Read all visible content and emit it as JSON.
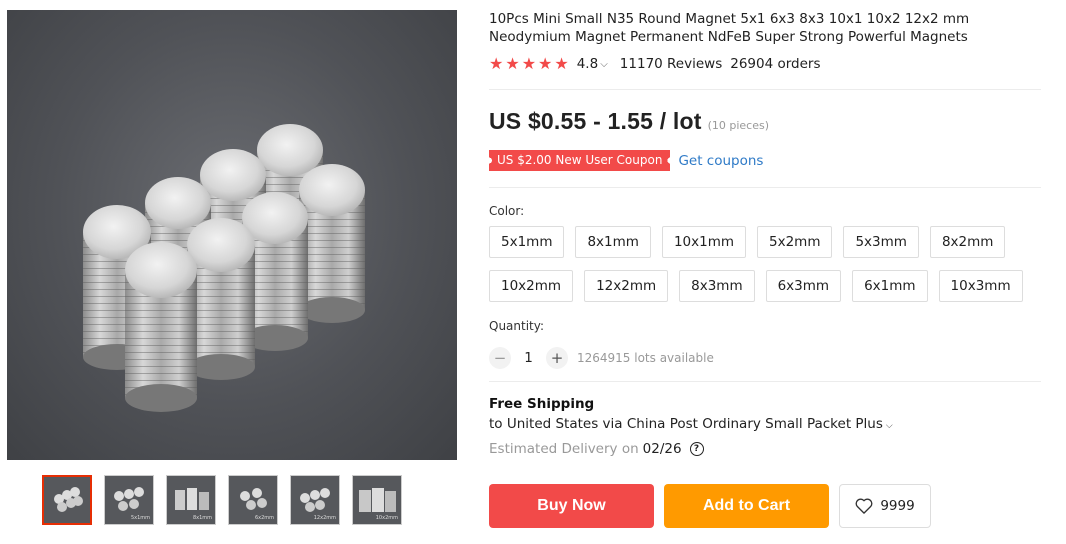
{
  "product": {
    "title": "10Pcs Mini Small N35 Round Magnet 5x1 6x3 8x3 10x1 10x2 12x2 mm Neodymium Magnet Permanent NdFeB Super Strong Powerful Magnets",
    "rating": "4.8",
    "reviews": "11170 Reviews",
    "orders": "26904 orders",
    "price": "US $0.55 - 1.55 / lot",
    "pieces": "(10 pieces)"
  },
  "coupon": {
    "label": "US $2.00 New User Coupon",
    "link": "Get coupons"
  },
  "color": {
    "label": "Color:",
    "options_row1": [
      "5x1mm",
      "8x1mm",
      "10x1mm",
      "5x2mm",
      "5x3mm",
      "8x2mm"
    ],
    "options_row2": [
      "10x2mm",
      "12x2mm",
      "8x3mm",
      "6x3mm",
      "6x1mm",
      "10x3mm"
    ]
  },
  "quantity": {
    "label": "Quantity:",
    "minus": "−",
    "value": "1",
    "plus": "+",
    "available": "1264915 lots available"
  },
  "shipping": {
    "title": "Free Shipping",
    "to": "to United States via China Post Ordinary Small Packet Plus",
    "estimated_label": "Estimated Delivery on",
    "date": "02/26"
  },
  "actions": {
    "buy_now": "Buy Now",
    "add_to_cart": "Add to Cart",
    "wishlist_count": "9999"
  },
  "gallery": {
    "thumb_labels": [
      "",
      "5x1mm",
      "8x1mm",
      "6x2mm",
      "12x2mm",
      "10x2mm"
    ],
    "active_index": 0
  },
  "colors": {
    "accent": "#f24a49",
    "cart": "#ff9a00",
    "link": "#2e7ac7"
  }
}
